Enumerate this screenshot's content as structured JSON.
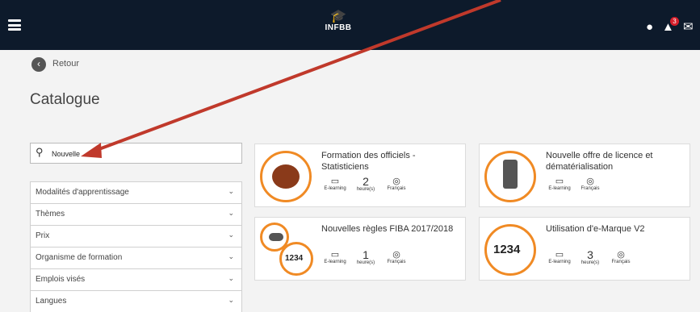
{
  "header": {
    "logo_text": "INFBB",
    "notif_count": "3"
  },
  "nav": {
    "back_label": "Retour"
  },
  "page": {
    "title": "Catalogue"
  },
  "search": {
    "value": "Nouvelle"
  },
  "filters": [
    "Modalités d'apprentissage",
    "Thèmes",
    "Prix",
    "Organisme de formation",
    "Emplois visés",
    "Langues"
  ],
  "courses": [
    {
      "title": "Formation des officiels - Statisticiens",
      "mode": "E-learning",
      "duration": "2",
      "duration_unit": "heure(s)",
      "language": "Français"
    },
    {
      "title": "Nouvelle offre de licence et dématérialisation",
      "mode": "E-learning",
      "language": "Français"
    },
    {
      "title": "Nouvelles règles FIBA 2017/2018",
      "mode": "E-learning",
      "duration": "1",
      "duration_unit": "heure(s)",
      "language": "Français"
    },
    {
      "title": "Utilisation d'e-Marque V2",
      "mode": "E-learning",
      "duration": "3",
      "duration_unit": "heure(s)",
      "language": "Français"
    }
  ],
  "colors": {
    "topbar": "#0d1a2b",
    "accent": "#f08a24",
    "annotation_arrow": "#c0392b"
  }
}
